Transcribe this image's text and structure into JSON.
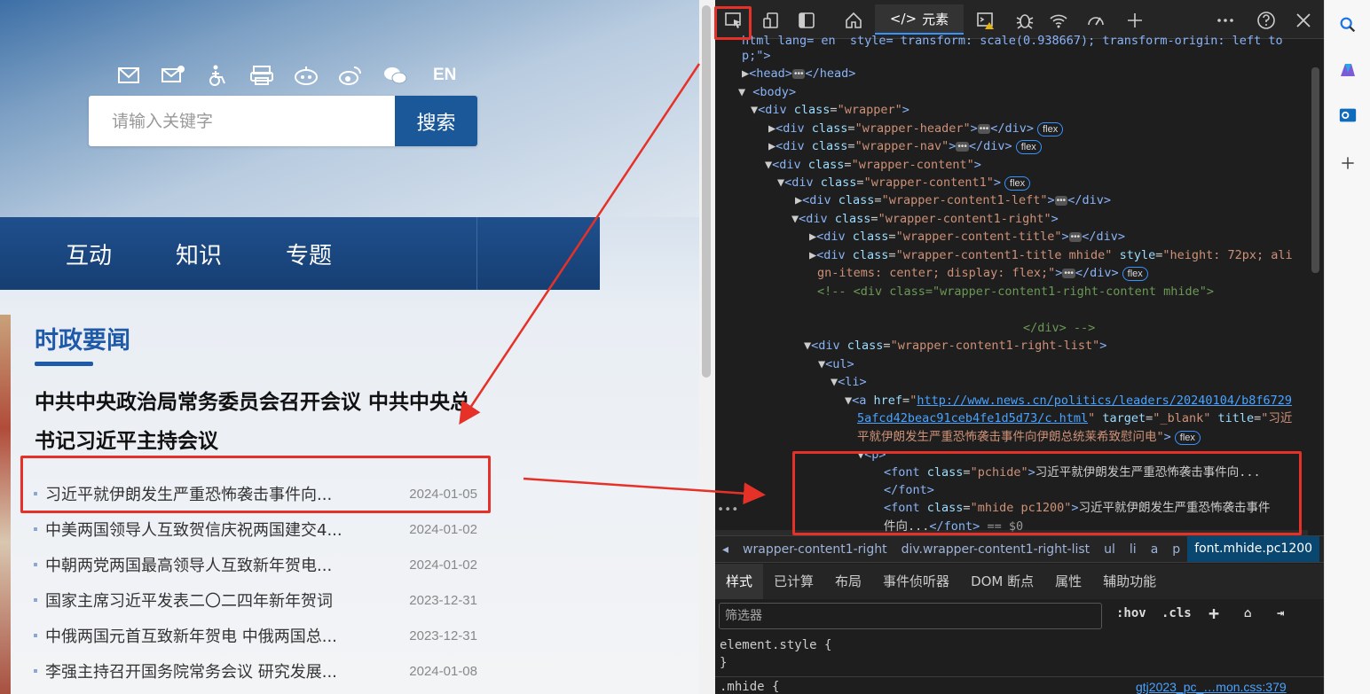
{
  "website": {
    "lang_label": "EN",
    "search_placeholder": "请输入关键字",
    "search_button": "搜索",
    "nav": [
      "互动",
      "知识",
      "专题"
    ],
    "section_title": "时政要闻",
    "headline": "中共中央政治局常务委员会召开会议 中共中央总书记习近平主持会议",
    "news": [
      {
        "title": "习近平就伊朗发生严重恐怖袭击事件向...",
        "date": "2024-01-05"
      },
      {
        "title": "中美两国领导人互致贺信庆祝两国建交4...",
        "date": "2024-01-02"
      },
      {
        "title": "中朝两党两国最高领导人互致新年贺电...",
        "date": "2024-01-02"
      },
      {
        "title": "国家主席习近平发表二〇二四年新年贺词",
        "date": "2023-12-31"
      },
      {
        "title": "中俄两国元首互致新年贺电 中俄两国总...",
        "date": "2023-12-31"
      },
      {
        "title": "李强主持召开国务院常务会议 研究发展...",
        "date": "2024-01-08"
      }
    ]
  },
  "devtools": {
    "tab_elements": "元素",
    "dom": {
      "l0": "html lang= en  style= transform: scale(0.938667); transform-origin: left to",
      "l1": "p;\">",
      "head": "head",
      "body": "body",
      "wrapper_class": "wrapper",
      "header_class": "wrapper-header",
      "nav_class": "wrapper-nav",
      "content_class": "wrapper-content",
      "content1_class": "wrapper-content1",
      "content1_left_class": "wrapper-content1-left",
      "content1_right_class": "wrapper-content1-right",
      "content_title_class": "wrapper-content-title",
      "content1_title_class": "wrapper-content1-title mhide",
      "content1_title_style": "height: 72px; ali",
      "content1_title_style2": "gn-items: center; display: flex;",
      "comment1": "<!-- <div class=\"wrapper-content1-right-content mhide\">",
      "comment2": "</div> -->",
      "right_list_class": "wrapper-content1-right-list",
      "href": "http://www.news.cn/politics/leaders/20240104/b8f6729",
      "href2": "5afcd42beac91ceb4fe1d5d73/c.html",
      "target": "_blank",
      "title_attr": "习近",
      "title_attr2": "平就伊朗发生严重恐怖袭击事件向伊朗总统莱希致慰问电",
      "font1_class": "pchide",
      "font1_text": "习近平就伊朗发生严重恐怖袭击事件向...",
      "font2_class": "mhide pc1200",
      "font2_text": "习近平就伊朗发生严重恐怖袭击事件",
      "font2_text2": "件向...",
      "selected_marker": "== $0",
      "badge": "flex"
    },
    "breadcrumb": [
      "wrapper-content1-right",
      "div.wrapper-content1-right-list",
      "ul",
      "li",
      "a",
      "p",
      "font.mhide.pc1200"
    ],
    "style_tabs": [
      "样式",
      "已计算",
      "布局",
      "事件侦听器",
      "DOM 断点",
      "属性",
      "辅助功能"
    ],
    "filter_placeholder": "筛选器",
    "filter_hov": ":hov",
    "filter_cls": ".cls",
    "css_rule1": "element.style {",
    "css_rule1_end": "}",
    "css_rule2": ".mhide {",
    "css_source": "gtj2023_pc_…mon.css:379"
  },
  "colors": {
    "annotation_red": "#e53128",
    "site_blue": "#1e5aa8",
    "devtools_bg": "#1e1e1e"
  }
}
